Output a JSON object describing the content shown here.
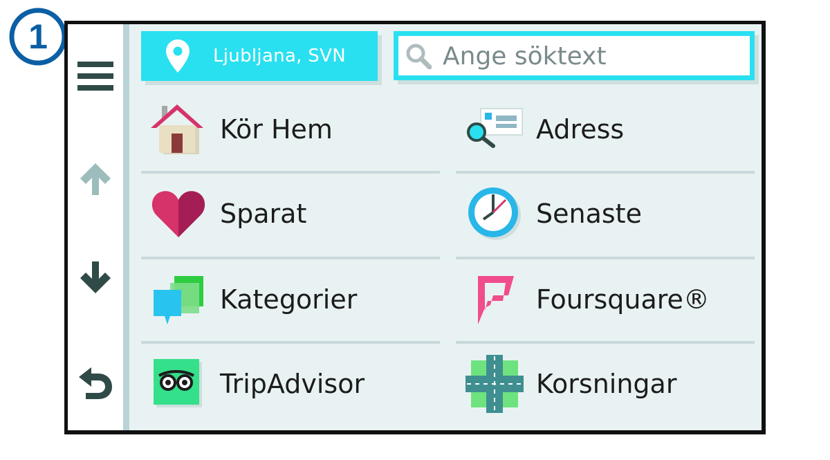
{
  "callout": {
    "number": "1"
  },
  "sidebar": {
    "menu_icon": "hamburger-menu-icon",
    "up_icon": "arrow-up-icon",
    "down_icon": "arrow-down-icon",
    "back_icon": "back-arrow-icon"
  },
  "location": {
    "label": "Ljubljana, SVN",
    "icon": "map-pin-icon"
  },
  "search": {
    "placeholder": "Ange söktext",
    "value": "",
    "icon": "search-icon"
  },
  "tiles": [
    {
      "label": "Kör Hem",
      "icon": "home-icon"
    },
    {
      "label": "Adress",
      "icon": "address-icon"
    },
    {
      "label": "Sparat",
      "icon": "heart-icon"
    },
    {
      "label": "Senaste",
      "icon": "clock-icon"
    },
    {
      "label": "Kategorier",
      "icon": "categories-icon"
    },
    {
      "label": "Foursquare®",
      "icon": "foursquare-icon"
    },
    {
      "label": "TripAdvisor",
      "icon": "tripadvisor-icon"
    },
    {
      "label": "Korsningar",
      "icon": "intersection-icon"
    }
  ],
  "colors": {
    "accent": "#29e0f0",
    "sidebar_icons": "#2f4a47",
    "disabled_icon": "#9dbcbc"
  }
}
